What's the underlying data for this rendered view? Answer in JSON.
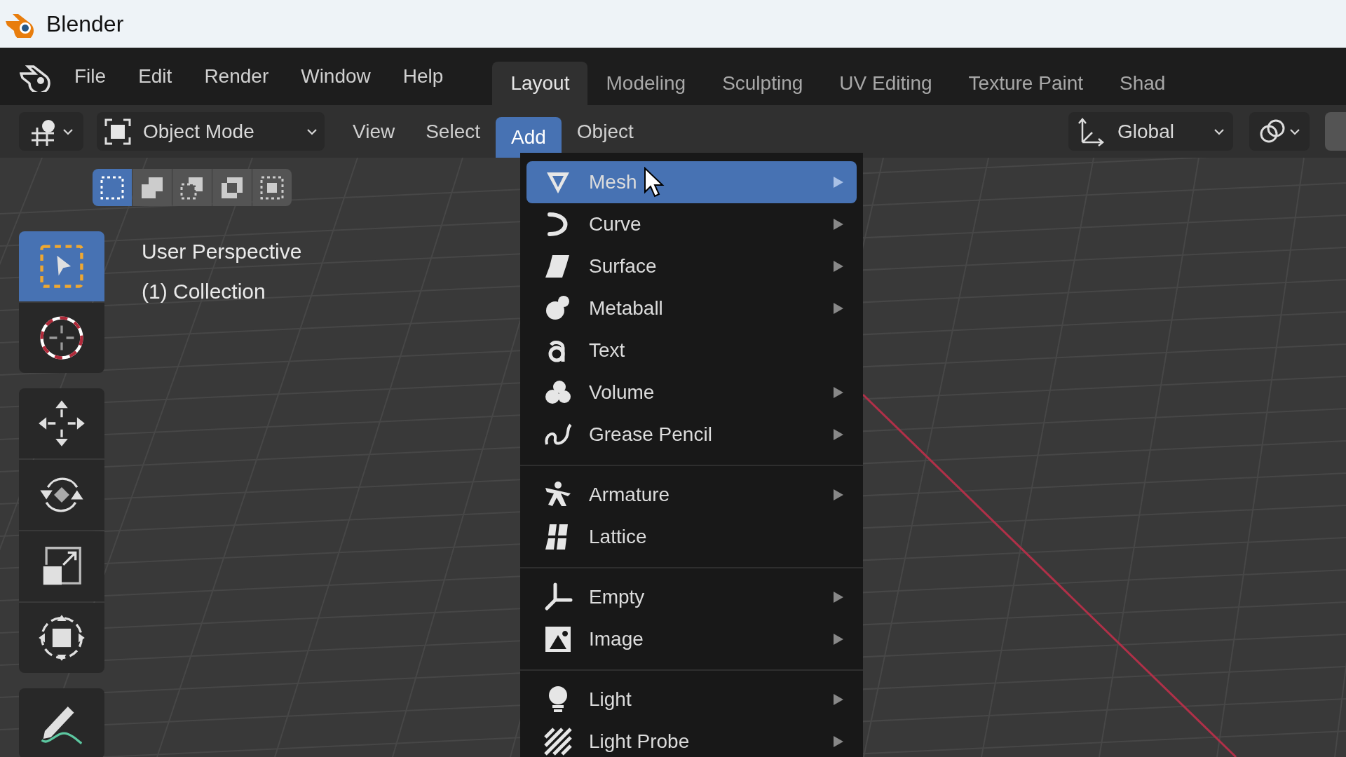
{
  "window": {
    "title": "Blender"
  },
  "menubar": {
    "items": [
      "File",
      "Edit",
      "Render",
      "Window",
      "Help"
    ]
  },
  "workspaces": [
    {
      "label": "Layout",
      "selected": true
    },
    {
      "label": "Modeling",
      "selected": false
    },
    {
      "label": "Sculpting",
      "selected": false
    },
    {
      "label": "UV Editing",
      "selected": false
    },
    {
      "label": "Texture Paint",
      "selected": false
    },
    {
      "label": "Shad",
      "selected": false
    }
  ],
  "header": {
    "mode": "Object Mode",
    "menus": [
      {
        "label": "View",
        "selected": false
      },
      {
        "label": "Select",
        "selected": false
      },
      {
        "label": "Add",
        "selected": true
      },
      {
        "label": "Object",
        "selected": false
      }
    ],
    "orientation": "Global"
  },
  "select_modes": [
    {
      "kind": "set",
      "selected": true
    },
    {
      "kind": "extend",
      "selected": false
    },
    {
      "kind": "subtract",
      "selected": false
    },
    {
      "kind": "invert",
      "selected": false
    },
    {
      "kind": "intersect",
      "selected": false
    }
  ],
  "tool_groups": [
    [
      {
        "kind": "select",
        "selected": true
      },
      {
        "kind": "cursor",
        "selected": false
      }
    ],
    [
      {
        "kind": "move",
        "selected": false
      },
      {
        "kind": "rotate",
        "selected": false
      },
      {
        "kind": "scale",
        "selected": false
      },
      {
        "kind": "transform",
        "selected": false
      }
    ],
    [
      {
        "kind": "annotate",
        "selected": false
      }
    ]
  ],
  "viewport": {
    "overlay": [
      "User Perspective",
      "(1) Collection"
    ]
  },
  "add_menu": {
    "sections": [
      [
        {
          "label": "Mesh",
          "kind": "mesh",
          "submenu": true,
          "selected": true
        },
        {
          "label": "Curve",
          "kind": "curve",
          "submenu": true,
          "selected": false
        },
        {
          "label": "Surface",
          "kind": "surface",
          "submenu": true,
          "selected": false
        },
        {
          "label": "Metaball",
          "kind": "metaball",
          "submenu": true,
          "selected": false
        },
        {
          "label": "Text",
          "kind": "text",
          "submenu": false,
          "selected": false
        },
        {
          "label": "Volume",
          "kind": "volume",
          "submenu": true,
          "selected": false
        },
        {
          "label": "Grease Pencil",
          "kind": "grease_pencil",
          "submenu": true,
          "selected": false
        }
      ],
      [
        {
          "label": "Armature",
          "kind": "armature",
          "submenu": true,
          "selected": false
        },
        {
          "label": "Lattice",
          "kind": "lattice",
          "submenu": false,
          "selected": false
        }
      ],
      [
        {
          "label": "Empty",
          "kind": "empty",
          "submenu": true,
          "selected": false
        },
        {
          "label": "Image",
          "kind": "image",
          "submenu": true,
          "selected": false
        }
      ],
      [
        {
          "label": "Light",
          "kind": "light",
          "submenu": true,
          "selected": false
        },
        {
          "label": "Light Probe",
          "kind": "light_probe",
          "submenu": true,
          "selected": false
        }
      ]
    ]
  }
}
